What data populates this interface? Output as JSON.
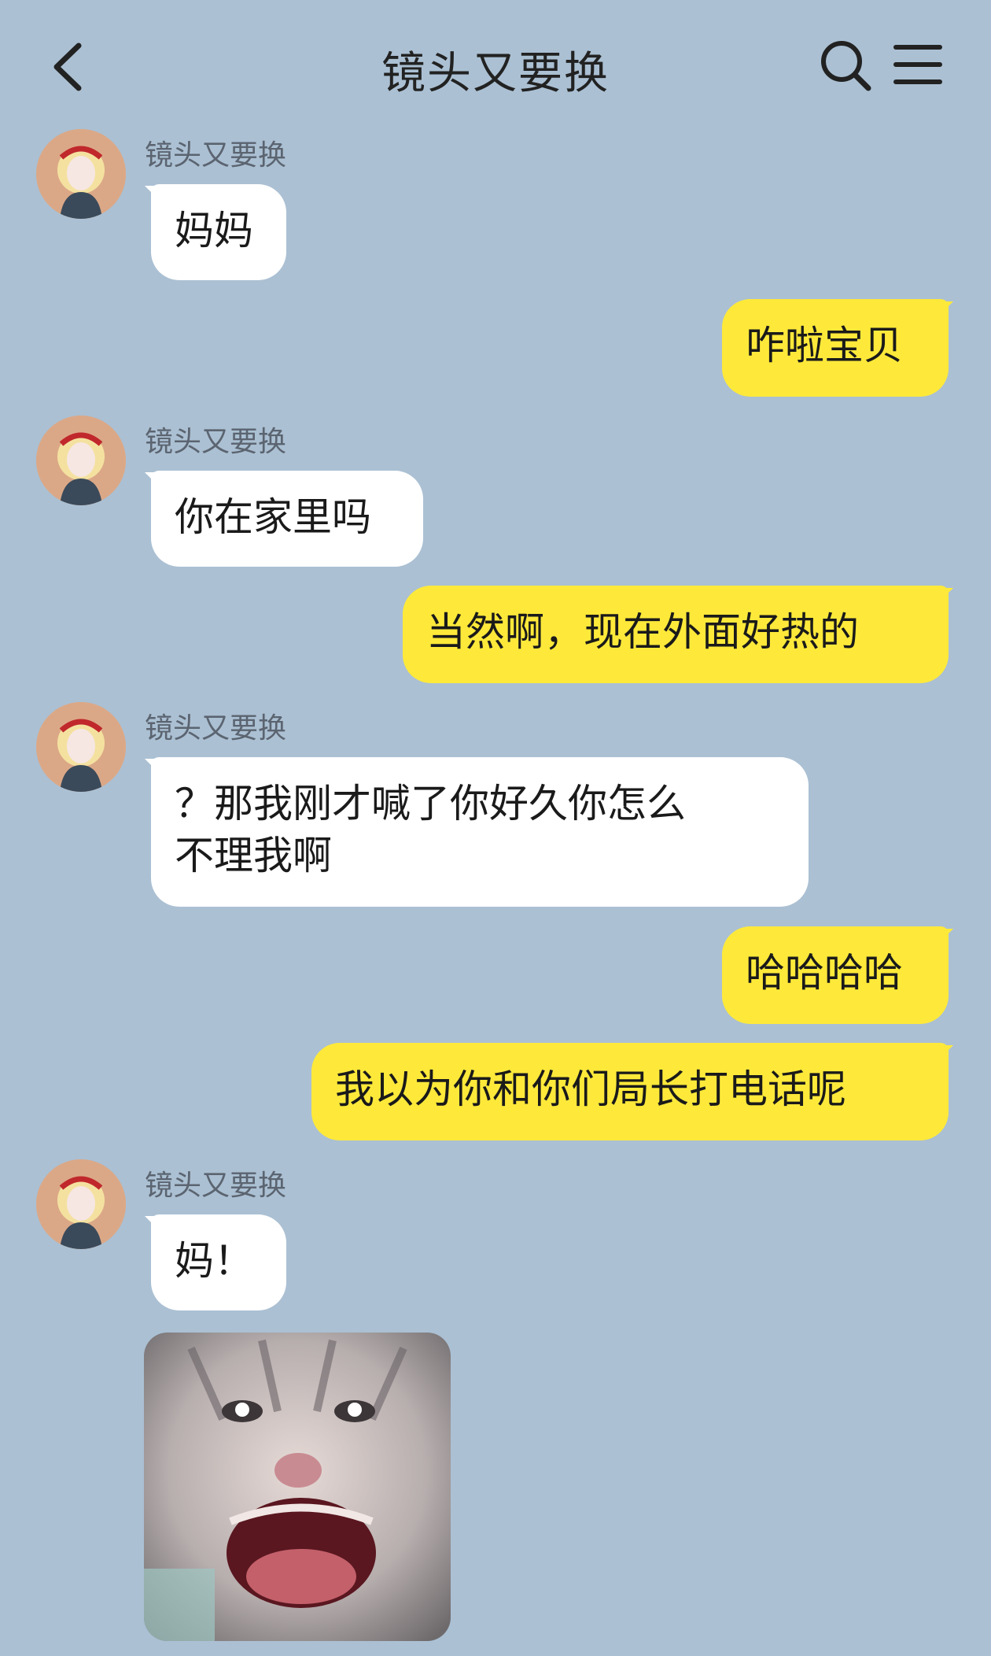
{
  "header": {
    "title": "镜头又要换"
  },
  "colors": {
    "background": "#abc0d3",
    "incoming_bubble": "#ffffff",
    "outgoing_bubble": "#fee93a"
  },
  "icons": {
    "back": "chevron-left-icon",
    "search": "search-icon",
    "menu": "hamburger-menu-icon"
  },
  "messages": [
    {
      "side": "left",
      "sender": "镜头又要换",
      "text": "妈妈"
    },
    {
      "side": "right",
      "text": "咋啦宝贝"
    },
    {
      "side": "left",
      "sender": "镜头又要换",
      "text": "你在家里吗"
    },
    {
      "side": "right",
      "text": "当然啊，现在外面好热的"
    },
    {
      "side": "left",
      "sender": "镜头又要换",
      "text": "？那我刚才喊了你好久你怎么\n不理我啊"
    },
    {
      "side": "right",
      "text": "哈哈哈哈"
    },
    {
      "side": "right",
      "text": "我以为你和你们局长打电话呢"
    },
    {
      "side": "left",
      "sender": "镜头又要换",
      "text": "妈！"
    },
    {
      "side": "left",
      "type": "sticker",
      "sticker": "screaming-cat-sticker"
    }
  ]
}
